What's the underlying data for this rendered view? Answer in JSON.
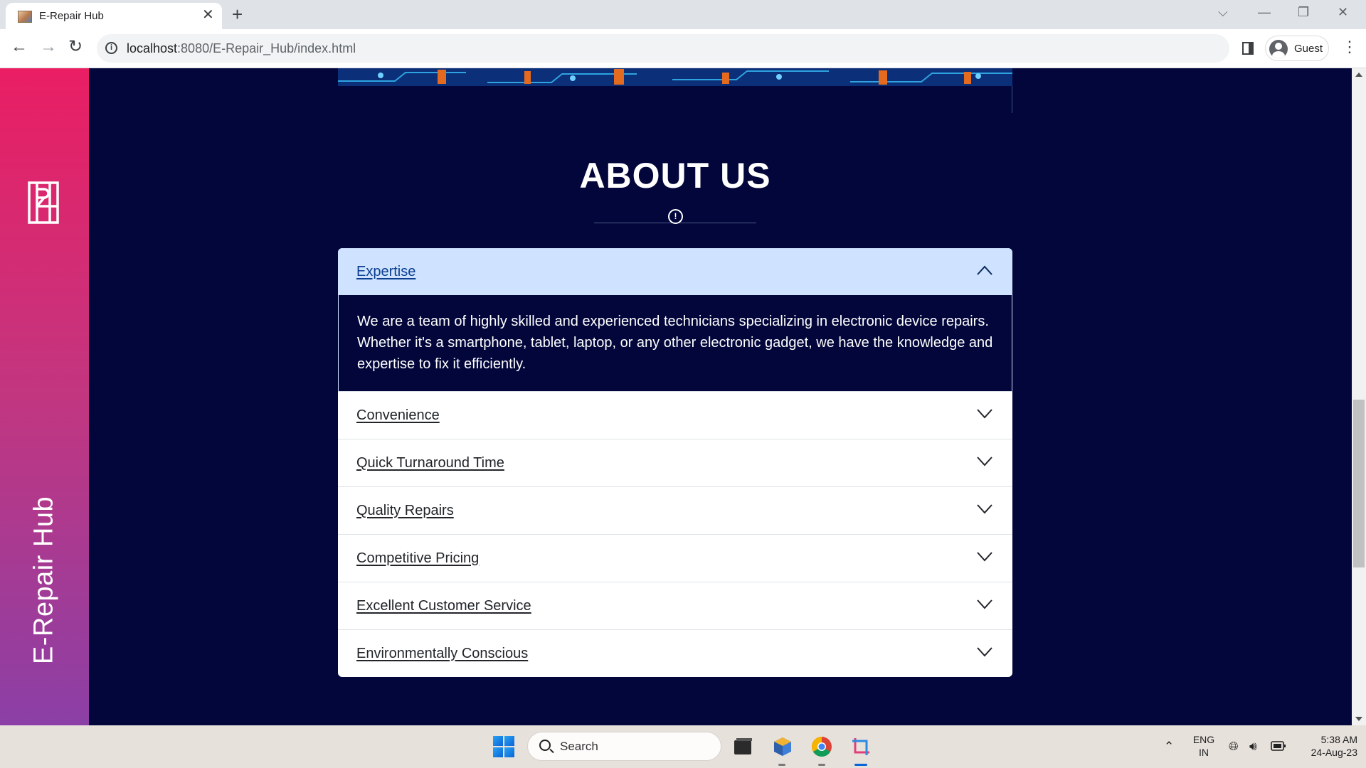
{
  "browser": {
    "tab_title": "E-Repair Hub",
    "tab_close": "✕",
    "new_tab": "+",
    "url_host": "localhost",
    "url_path": ":8080/E-Repair_Hub/index.html",
    "profile_label": "Guest",
    "window_controls": {
      "dropdown": "⌵",
      "minimize": "—",
      "restore": "❐",
      "close": "✕"
    }
  },
  "sidebar": {
    "brand": "E-Repair Hub",
    "gradient": [
      "#ea1e63",
      "#c23680",
      "#8b3fa6"
    ]
  },
  "about": {
    "title": "ABOUT US",
    "divider_icon": "!"
  },
  "accordion": {
    "items": [
      {
        "label": "Expertise",
        "expanded": true,
        "body": "We are a team of highly skilled and experienced technicians specializing in electronic device repairs. Whether it's a smartphone, tablet, laptop, or any other electronic gadget, we have the knowledge and expertise to fix it efficiently."
      },
      {
        "label": "Convenience",
        "expanded": false
      },
      {
        "label": "Quick Turnaround Time",
        "expanded": false
      },
      {
        "label": "Quality Repairs",
        "expanded": false
      },
      {
        "label": "Competitive Pricing",
        "expanded": false
      },
      {
        "label": "Excellent Customer Service",
        "expanded": false
      },
      {
        "label": "Environmentally Conscious",
        "expanded": false
      }
    ]
  },
  "taskbar": {
    "search_placeholder": "Search",
    "language_line1": "ENG",
    "language_line2": "IN",
    "time": "5:38 AM",
    "date": "24-Aug-23"
  },
  "colors": {
    "page_bg": "#02063a",
    "accordion_active_bg": "#cfe2ff",
    "accent": "#ea1e63"
  }
}
